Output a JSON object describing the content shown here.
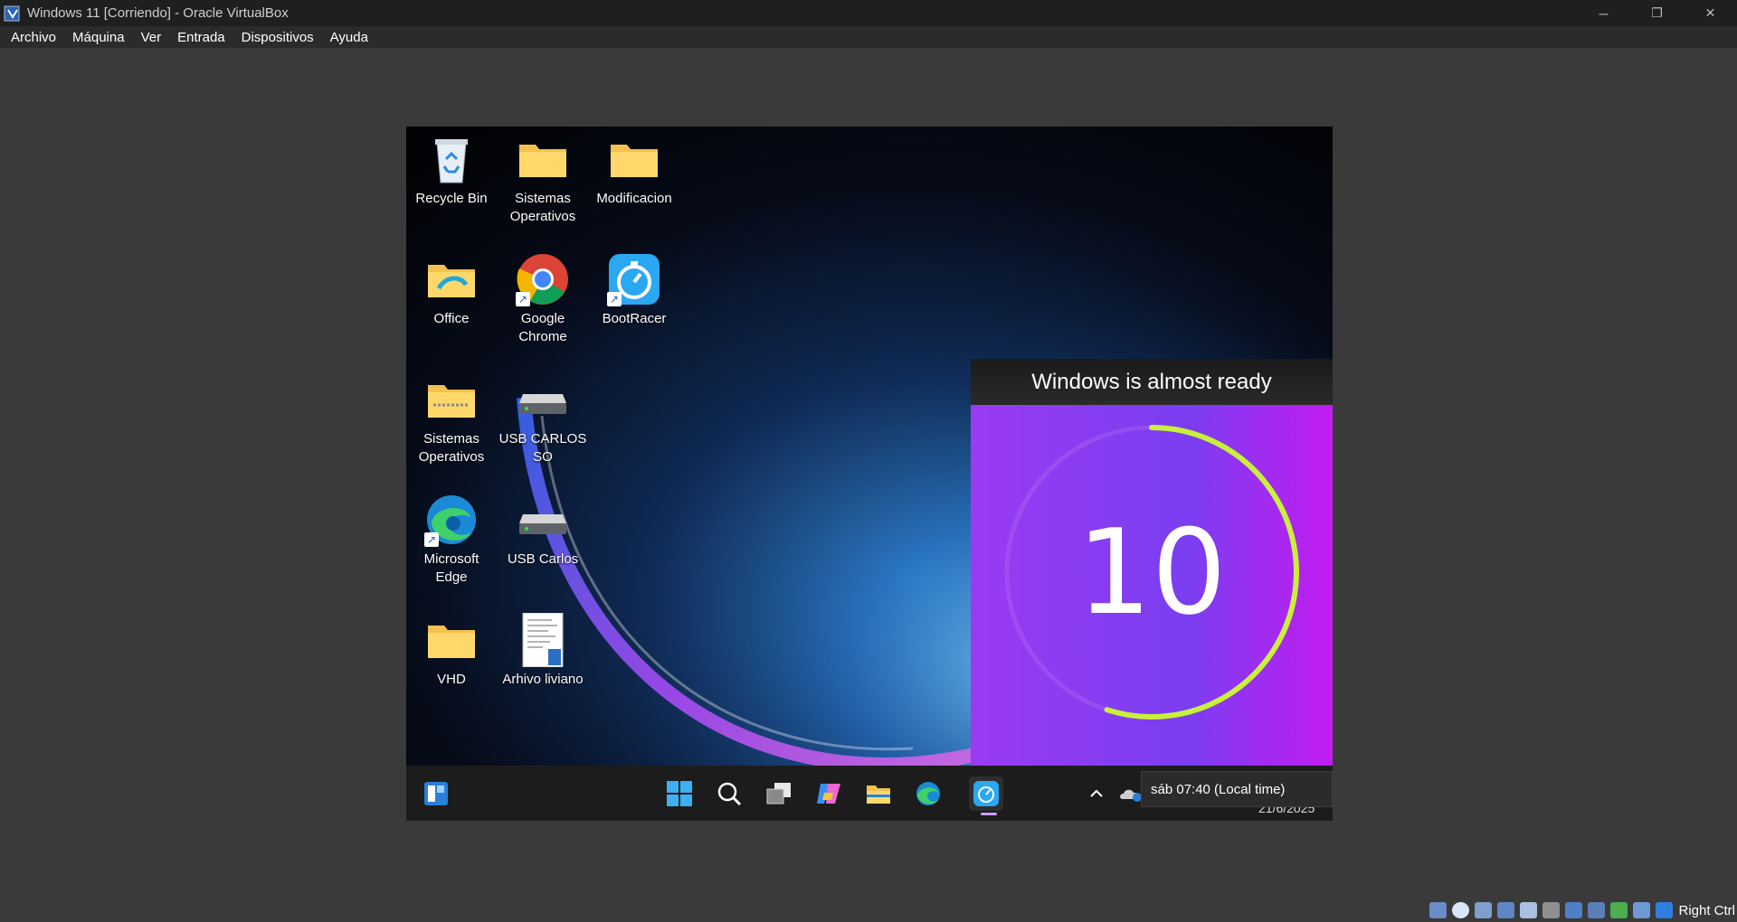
{
  "window": {
    "title": "Windows 11 [Corriendo] - Oracle VirtualBox",
    "icon": "virtualbox-icon"
  },
  "window_controls": {
    "minimize": "─",
    "restore": "❐",
    "close": "✕"
  },
  "menu": [
    "Archivo",
    "Máquina",
    "Ver",
    "Entrada",
    "Dispositivos",
    "Ayuda"
  ],
  "desktop_icons": [
    {
      "label": "Recycle Bin",
      "icon": "recycle-bin-icon"
    },
    {
      "label": "Sistemas Operativos",
      "icon": "folder-icon"
    },
    {
      "label": "Modificacion",
      "icon": "folder-icon"
    },
    {
      "label": "Office",
      "icon": "folder-icon"
    },
    {
      "label": "Google Chrome",
      "icon": "chrome-icon"
    },
    {
      "label": "BootRacer",
      "icon": "bootracer-icon"
    },
    {
      "label": "Sistemas Operativos",
      "icon": "zip-folder-icon"
    },
    {
      "label": "USB CARLOS SO",
      "icon": "drive-icon"
    },
    {
      "label": "Microsoft Edge",
      "icon": "edge-icon"
    },
    {
      "label": "USB Carlos",
      "icon": "drive-icon"
    },
    {
      "label": "VHD",
      "icon": "folder-icon"
    },
    {
      "label": "Arhivo liviano",
      "icon": "document-icon"
    }
  ],
  "bootracer": {
    "header": "Windows is almost ready",
    "countdown": "10",
    "progress_fraction": 0.55,
    "accent": "#c8f03c"
  },
  "taskbar": {
    "items": [
      "widgets-icon",
      "start-icon",
      "search-icon",
      "task-view-icon",
      "copilot-icon",
      "file-explorer-icon",
      "edge-icon",
      "bootracer-icon"
    ],
    "active": "bootracer-icon",
    "tray": [
      "chevron-up-icon",
      "onedrive-icon"
    ]
  },
  "clock_tooltip": "sáb 07:40 (Local time)",
  "clock_date_partial": "21/6/2025",
  "statusbar": {
    "right_ctrl": "Right Ctrl"
  }
}
